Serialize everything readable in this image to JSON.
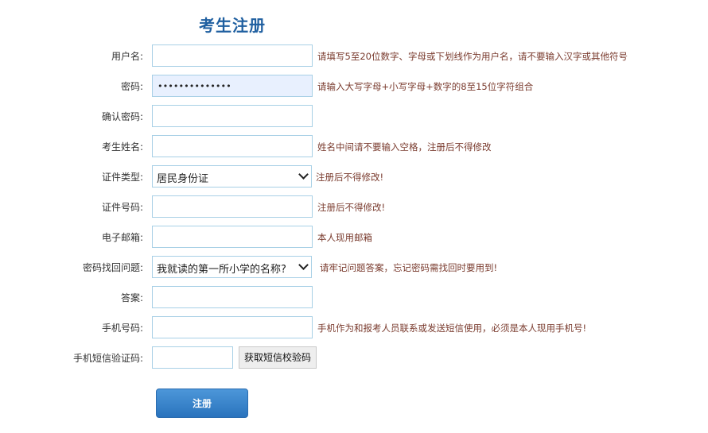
{
  "title": "考生注册",
  "fields": {
    "username": {
      "label": "用户名:",
      "value": "",
      "hint": "请填写5至20位数字、字母或下划线作为用户名，请不要输入汉字或其他符号"
    },
    "password": {
      "label": "密码:",
      "value": "••••••••••••••",
      "hint": "请输入大写字母+小写字母+数字的8至15位字符组合"
    },
    "confirm_password": {
      "label": "确认密码:",
      "value": "",
      "hint": ""
    },
    "name": {
      "label": "考生姓名:",
      "value": "",
      "hint": "姓名中间请不要输入空格，注册后不得修改"
    },
    "id_type": {
      "label": "证件类型:",
      "selected": "居民身份证",
      "hint": "注册后不得修改!"
    },
    "id_number": {
      "label": "证件号码:",
      "value": "",
      "hint": "注册后不得修改!"
    },
    "email": {
      "label": "电子邮箱:",
      "value": "",
      "hint": "本人现用邮箱"
    },
    "security_question": {
      "label": "密码找回问题:",
      "selected": "我就读的第一所小学的名称?",
      "hint": "请牢记问题答案，忘记密码需找回时要用到!"
    },
    "answer": {
      "label": "答案:",
      "value": "",
      "hint": ""
    },
    "phone": {
      "label": "手机号码:",
      "value": "",
      "hint": "手机作为和报考人员联系或发送短信使用，必须是本人现用手机号!"
    },
    "sms_code": {
      "label": "手机短信验证码:",
      "value": "",
      "button": "获取短信校验码"
    }
  },
  "register_label": "注册"
}
